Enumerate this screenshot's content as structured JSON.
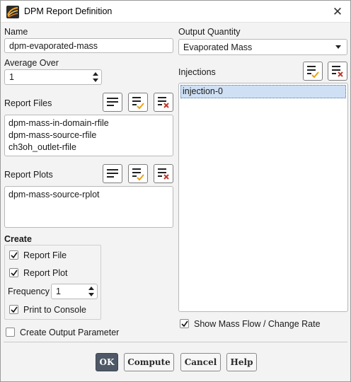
{
  "window": {
    "title": "DPM Report Definition",
    "close_glyph": "✕"
  },
  "name_field": {
    "label": "Name",
    "value": "dpm-evaporated-mass"
  },
  "average_over": {
    "label": "Average Over",
    "value": "1"
  },
  "report_files": {
    "label": "Report Files",
    "items": [
      "dpm-mass-in-domain-rfile",
      "dpm-mass-source-rfile",
      "ch3oh_outlet-rfile"
    ]
  },
  "report_plots": {
    "label": "Report Plots",
    "items": [
      "dpm-mass-source-rplot"
    ]
  },
  "create": {
    "label": "Create",
    "report_file": {
      "label": "Report File",
      "checked": true
    },
    "report_plot": {
      "label": "Report Plot",
      "checked": true
    },
    "frequency": {
      "label": "Frequency",
      "value": "1"
    },
    "print_to_console": {
      "label": "Print to Console",
      "checked": true
    }
  },
  "create_output_parameter": {
    "label": "Create Output Parameter",
    "checked": false
  },
  "output_quantity": {
    "label": "Output Quantity",
    "value": "Evaporated Mass"
  },
  "injections": {
    "label": "Injections",
    "items": [
      "injection-0"
    ],
    "selected_index": 0
  },
  "show_mass_flow": {
    "label": "Show Mass Flow / Change Rate",
    "checked": true
  },
  "buttons": {
    "ok": "OK",
    "compute": "Compute",
    "cancel": "Cancel",
    "help": "Help"
  },
  "colors": {
    "accent_ok": "#4e5867",
    "selection": "#cfe0f5",
    "check_accent": "#e8a317",
    "clear_accent": "#c0392b"
  }
}
